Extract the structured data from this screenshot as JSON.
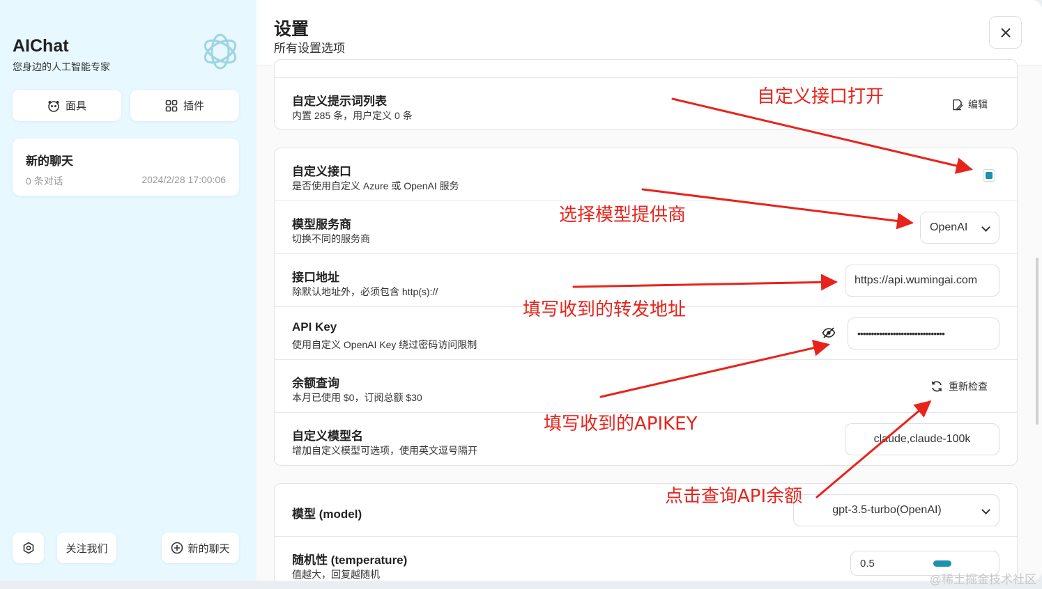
{
  "sidebar": {
    "app_title": "AIChat",
    "app_subtitle": "您身边的人工智能专家",
    "mask_button": "面具",
    "plugin_button": "插件",
    "chat_item": {
      "title": "新的聊天",
      "count": "0 条对话",
      "time": "2024/2/28 17:00:06"
    },
    "follow_button": "关注我们",
    "new_chat_button": "新的聊天"
  },
  "header": {
    "title": "设置",
    "subtitle": "所有设置选项"
  },
  "settings": {
    "prompt_list": {
      "title": "自定义提示词列表",
      "desc": "内置 285 条，用户定义 0 条",
      "edit_label": "编辑"
    },
    "custom_endpoint": {
      "title": "自定义接口",
      "desc": "是否使用自定义 Azure 或 OpenAI 服务",
      "checked": true
    },
    "provider": {
      "title": "模型服务商",
      "desc": "切换不同的服务商",
      "value": "OpenAI"
    },
    "endpoint_url": {
      "title": "接口地址",
      "desc": "除默认地址外，必须包含 http(s)://",
      "value": "https://api.wumingai.com"
    },
    "api_key": {
      "title": "API Key",
      "desc": "使用自定义 OpenAI Key 绕过密码访问限制",
      "value": "••••••••••••••••••••••••••••••••"
    },
    "balance": {
      "title": "余额查询",
      "desc": "本月已使用 $0，订阅总额 $30",
      "recheck_label": "重新检查"
    },
    "custom_models": {
      "title": "自定义模型名",
      "desc": "增加自定义模型可选项，使用英文逗号隔开",
      "value": "claude,claude-100k"
    },
    "model": {
      "title": "模型 (model)",
      "value": "gpt-3.5-turbo(OpenAI)"
    },
    "temperature": {
      "title": "随机性 (temperature)",
      "desc": "值越大，回复越随机",
      "value": "0.5"
    }
  },
  "annotations": {
    "a1": "自定义接口打开",
    "a2": "选择模型提供商",
    "a3": "填写收到的转发地址",
    "a4": "填写收到的APIKEY",
    "a5": "点击查询API余额"
  },
  "watermark": "@稀土掘金技术社区",
  "colors": {
    "accent": "#1d93ab",
    "sidebar_bg": "#e7f8ff",
    "annotation": "#e8231b"
  }
}
